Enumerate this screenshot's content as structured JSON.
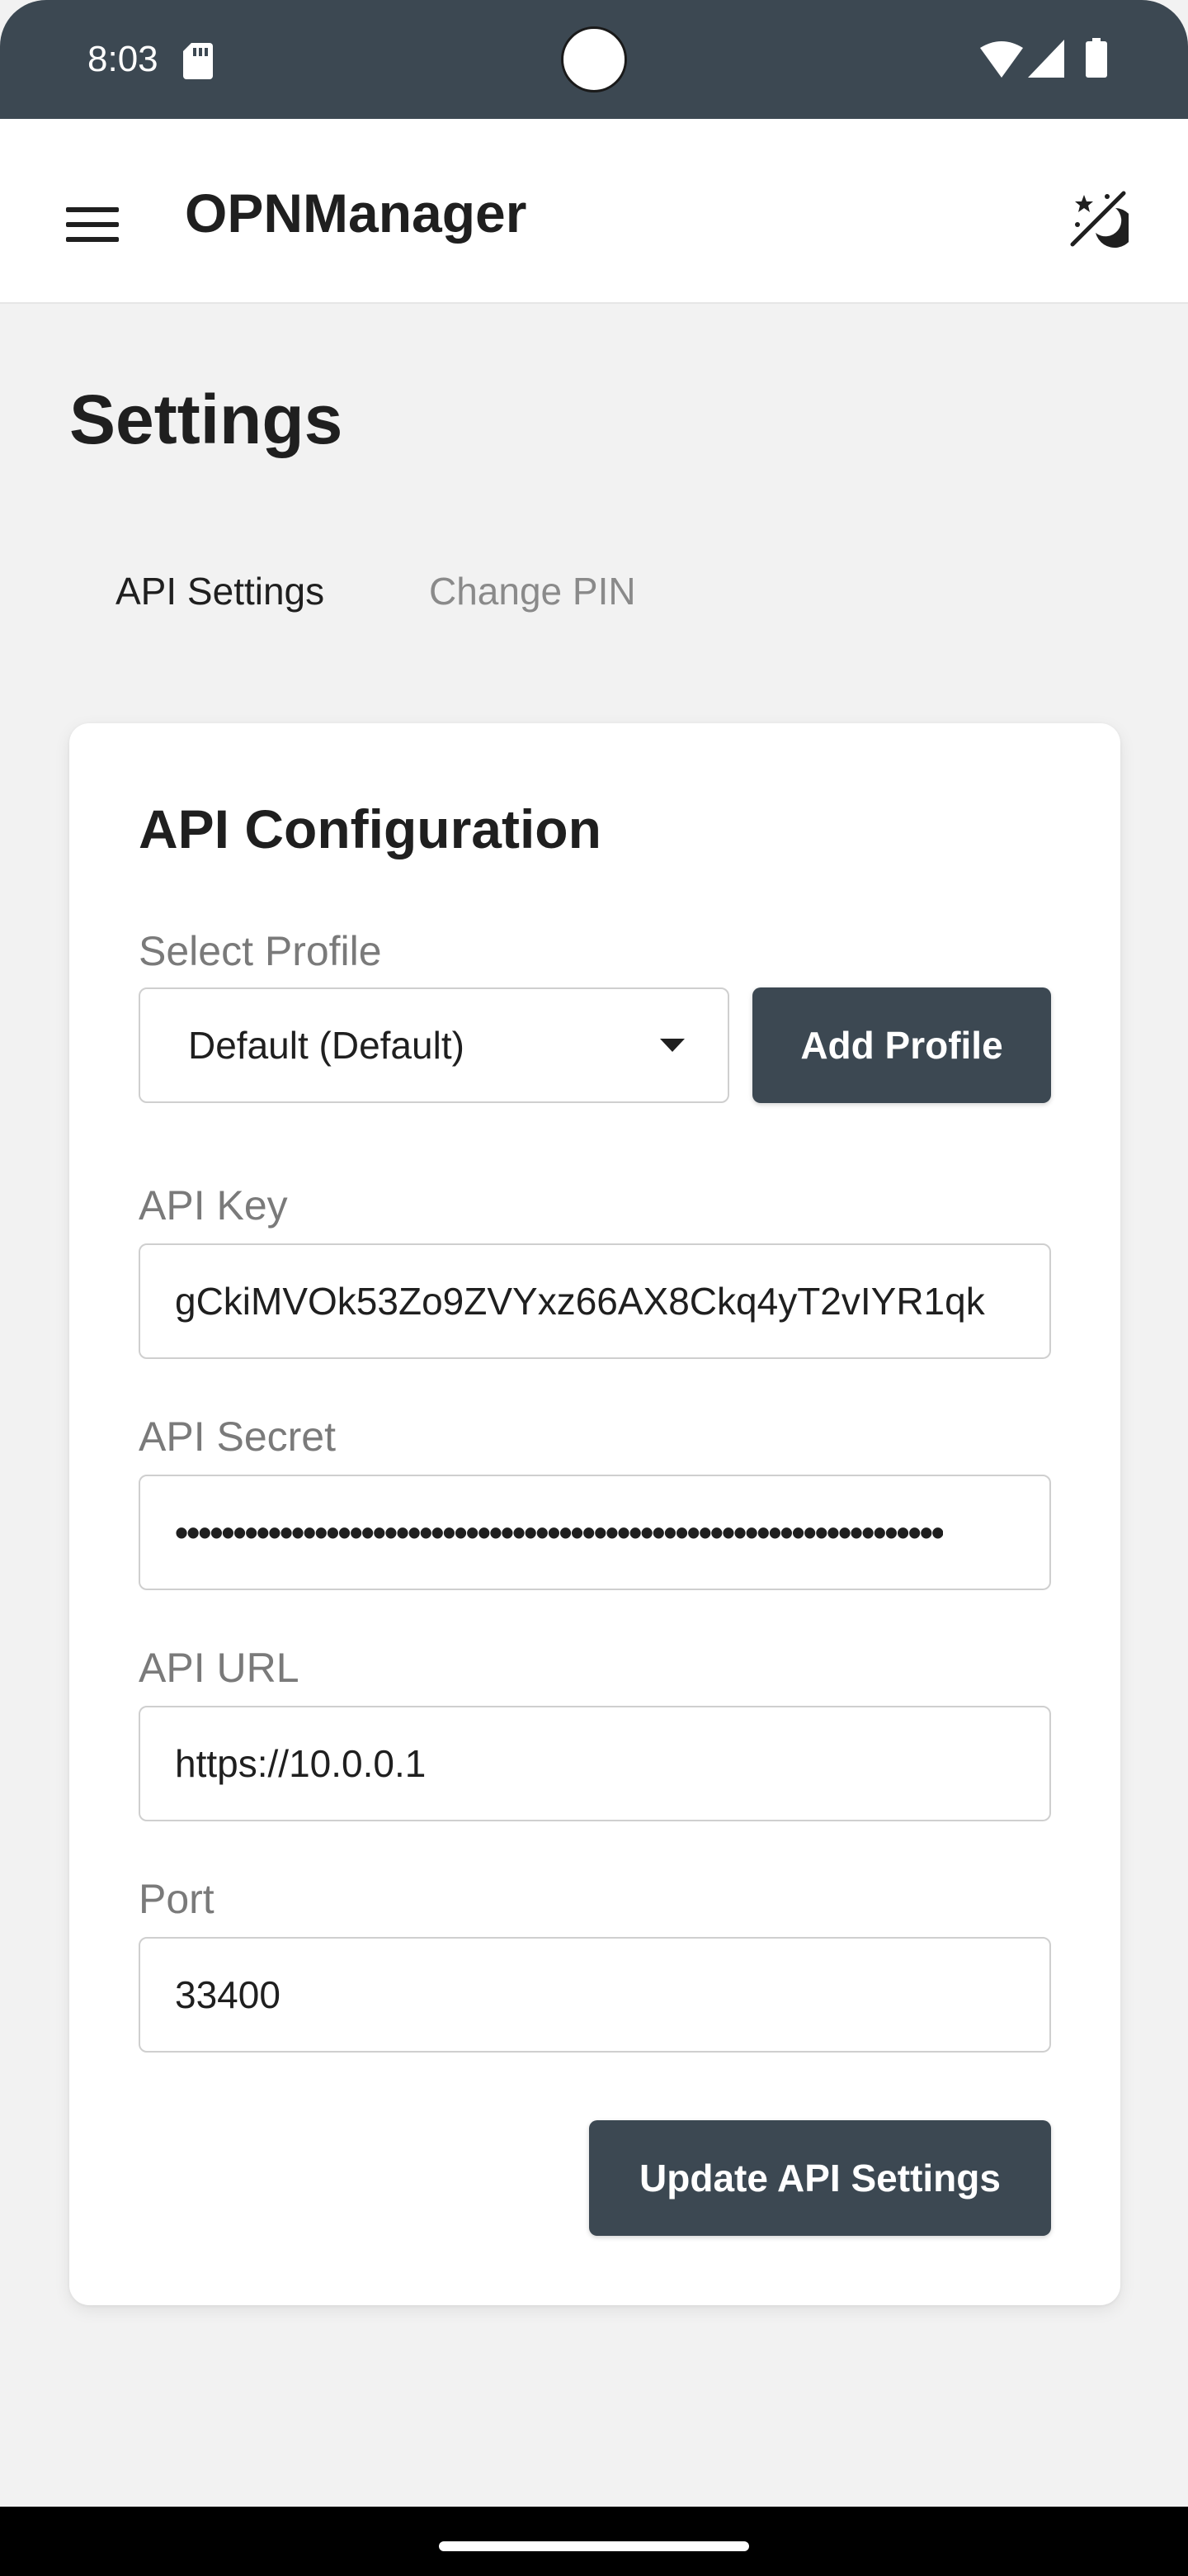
{
  "status_bar": {
    "time": "8:03",
    "icons": [
      "sd-card-icon",
      "wifi-icon",
      "signal-icon",
      "battery-icon"
    ]
  },
  "app_bar": {
    "title": "OPNManager",
    "menu_icon": "menu-icon",
    "theme_icon": "theme-toggle-icon"
  },
  "page": {
    "title": "Settings"
  },
  "tabs": [
    {
      "label": "API Settings",
      "active": true
    },
    {
      "label": "Change PIN",
      "active": false
    }
  ],
  "card": {
    "title": "API Configuration",
    "profile": {
      "label": "Select Profile",
      "selected": "Default (Default)",
      "add_button": "Add Profile"
    },
    "api_key": {
      "label": "API Key",
      "value": "gCkiMVOk53Zo9ZVYxz66AX8Ckq4yT2vIYR1qk"
    },
    "api_secret": {
      "label": "API Secret",
      "value": "••••••••••••••••••••••••••••••••••••••••••••••••••••••••••••••••••"
    },
    "api_url": {
      "label": "API URL",
      "value": "https://10.0.0.1"
    },
    "port": {
      "label": "Port",
      "value": "33400"
    },
    "update_button": "Update API Settings"
  },
  "colors": {
    "primary": "#3c4852",
    "background": "#f2f2f2",
    "card": "#ffffff",
    "label": "#7a7a7a",
    "inactive_tab": "#8a8a8a"
  }
}
